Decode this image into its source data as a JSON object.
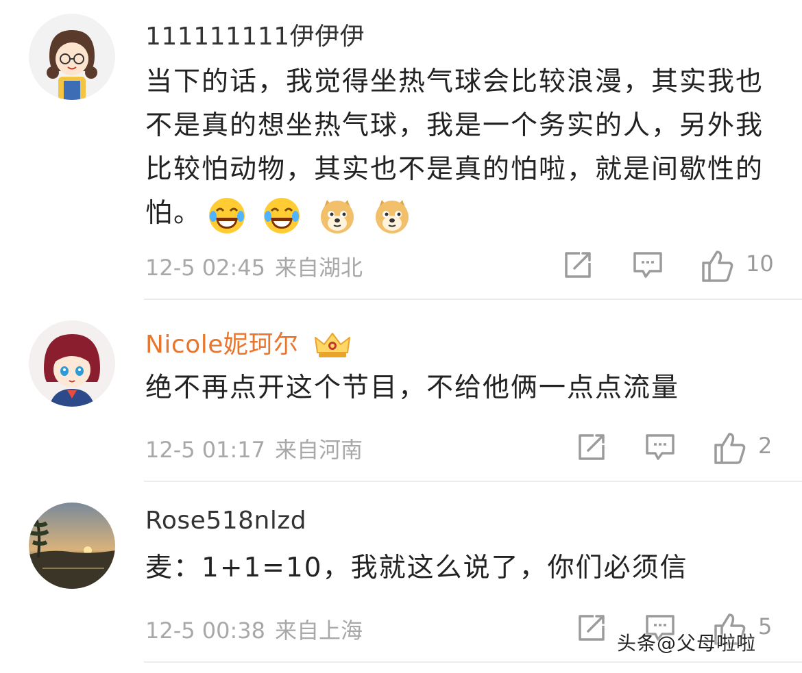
{
  "comments": [
    {
      "username": "111111111伊伊伊",
      "text": "当下的话，我觉得坐热气球会比较浪漫，其实我也不是真的想坐热气球，我是一个务实的人，另外我比较怕动物，其实也不是真的怕啦，就是间歇性的怕。",
      "emojis": [
        "laugh-cry-emoji",
        "laugh-cry-emoji",
        "doge-emoji",
        "doge-emoji"
      ],
      "date": "12-5 02:45",
      "location": "来自湖北",
      "likes": "10"
    },
    {
      "username": "Nicole妮珂尔",
      "badge": "crown-badge",
      "text": "绝不再点开这个节目，不给他俩一点点流量",
      "date": "12-5 01:17",
      "location": "来自河南",
      "likes": "2"
    },
    {
      "username": "Rose518nlzd",
      "text": "麦：1+1=10，我就这么说了，你们必须信",
      "date": "12-5 00:38",
      "location": "来自上海",
      "likes": "5"
    }
  ],
  "watermark": "头条@父母啦啦",
  "icons": {
    "share": "share-icon",
    "comment": "comment-icon",
    "like": "thumbs-up-icon"
  },
  "colors": {
    "vip_name": "#e8762d",
    "meta": "#a8a8a8",
    "text": "#222222"
  }
}
